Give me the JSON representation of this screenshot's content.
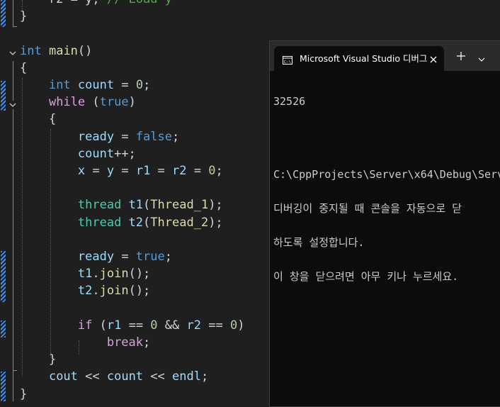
{
  "editor": {
    "lines": [
      {
        "id": "l0",
        "tokens": [
          [
            "op",
            "    r2 = y; "
          ],
          [
            "cmt",
            "// Load y"
          ]
        ]
      },
      {
        "id": "l1",
        "tokens": [
          [
            "op",
            "}"
          ]
        ]
      },
      {
        "id": "l2",
        "tokens": []
      },
      {
        "id": "l3",
        "tokens": [
          [
            "kw",
            "int"
          ],
          [
            "op",
            " "
          ],
          [
            "fn",
            "main"
          ],
          [
            "op",
            "()"
          ]
        ]
      },
      {
        "id": "l4",
        "tokens": [
          [
            "op",
            "{"
          ]
        ]
      },
      {
        "id": "l5",
        "tokens": [
          [
            "op",
            "    "
          ],
          [
            "kw",
            "int"
          ],
          [
            "op",
            " "
          ],
          [
            "var",
            "count"
          ],
          [
            "op",
            " = "
          ],
          [
            "num",
            "0"
          ],
          [
            "op",
            ";"
          ]
        ]
      },
      {
        "id": "l6",
        "tokens": [
          [
            "op",
            "    "
          ],
          [
            "ctl",
            "while"
          ],
          [
            "op",
            " ("
          ],
          [
            "kw",
            "true"
          ],
          [
            "op",
            ")"
          ]
        ]
      },
      {
        "id": "l7",
        "tokens": [
          [
            "op",
            "    {"
          ]
        ]
      },
      {
        "id": "l8",
        "tokens": [
          [
            "op",
            "        "
          ],
          [
            "var",
            "ready"
          ],
          [
            "op",
            " = "
          ],
          [
            "kw",
            "false"
          ],
          [
            "op",
            ";"
          ]
        ]
      },
      {
        "id": "l9",
        "tokens": [
          [
            "op",
            "        "
          ],
          [
            "var",
            "count"
          ],
          [
            "op",
            "++;"
          ]
        ]
      },
      {
        "id": "l10",
        "tokens": [
          [
            "op",
            "        "
          ],
          [
            "var",
            "x"
          ],
          [
            "op",
            " = "
          ],
          [
            "var",
            "y"
          ],
          [
            "op",
            " = "
          ],
          [
            "var",
            "r1"
          ],
          [
            "op",
            " = "
          ],
          [
            "var",
            "r2"
          ],
          [
            "op",
            " = "
          ],
          [
            "num",
            "0"
          ],
          [
            "op",
            ";"
          ]
        ]
      },
      {
        "id": "l11",
        "tokens": []
      },
      {
        "id": "l12",
        "tokens": [
          [
            "op",
            "        "
          ],
          [
            "ty",
            "thread"
          ],
          [
            "op",
            " "
          ],
          [
            "var",
            "t1"
          ],
          [
            "op",
            "("
          ],
          [
            "fn",
            "Thread_1"
          ],
          [
            "op",
            ");"
          ]
        ]
      },
      {
        "id": "l13",
        "tokens": [
          [
            "op",
            "        "
          ],
          [
            "ty",
            "thread"
          ],
          [
            "op",
            " "
          ],
          [
            "var",
            "t2"
          ],
          [
            "op",
            "("
          ],
          [
            "fn",
            "Thread_2"
          ],
          [
            "op",
            ");"
          ]
        ]
      },
      {
        "id": "l14",
        "tokens": []
      },
      {
        "id": "l15",
        "tokens": [
          [
            "op",
            "        "
          ],
          [
            "var",
            "ready"
          ],
          [
            "op",
            " = "
          ],
          [
            "kw",
            "true"
          ],
          [
            "op",
            ";"
          ]
        ]
      },
      {
        "id": "l16",
        "tokens": [
          [
            "op",
            "        "
          ],
          [
            "var",
            "t1"
          ],
          [
            "op",
            "."
          ],
          [
            "fn",
            "join"
          ],
          [
            "op",
            "();"
          ]
        ]
      },
      {
        "id": "l17",
        "tokens": [
          [
            "op",
            "        "
          ],
          [
            "var",
            "t2"
          ],
          [
            "op",
            "."
          ],
          [
            "fn",
            "join"
          ],
          [
            "op",
            "();"
          ]
        ]
      },
      {
        "id": "l18",
        "tokens": []
      },
      {
        "id": "l19",
        "tokens": [
          [
            "op",
            "        "
          ],
          [
            "ctl",
            "if"
          ],
          [
            "op",
            " ("
          ],
          [
            "var",
            "r1"
          ],
          [
            "op",
            " == "
          ],
          [
            "num",
            "0"
          ],
          [
            "op",
            " && "
          ],
          [
            "var",
            "r2"
          ],
          [
            "op",
            " == "
          ],
          [
            "num",
            "0"
          ],
          [
            "op",
            ")"
          ]
        ]
      },
      {
        "id": "l20",
        "tokens": [
          [
            "op",
            "            "
          ],
          [
            "ctl",
            "break"
          ],
          [
            "op",
            ";"
          ]
        ]
      },
      {
        "id": "l21",
        "tokens": [
          [
            "op",
            "    }"
          ]
        ]
      },
      {
        "id": "l22",
        "tokens": [
          [
            "op",
            "    "
          ],
          [
            "var",
            "cout"
          ],
          [
            "op",
            " << "
          ],
          [
            "var",
            "count"
          ],
          [
            "op",
            " << "
          ],
          [
            "var",
            "endl"
          ],
          [
            "op",
            ";"
          ]
        ]
      },
      {
        "id": "l23",
        "tokens": [
          [
            "op",
            "}"
          ]
        ]
      }
    ]
  },
  "console": {
    "tab_title": "Microsoft Visual Studio 디버그",
    "new_tab_icon": "plus-icon",
    "dropdown_icon": "chevron-down-icon",
    "close_icon": "close-icon",
    "output": [
      "32526",
      "",
      "C:\\CppProjects\\Server\\x64\\Debug\\Serv",
      "디버깅이 중지될 때 콘솔을 자동으로 닫",
      "하도록 설정합니다.",
      "이 창을 닫으려면 아무 키나 누르세요."
    ]
  },
  "colors": {
    "editor_bg": "#1f1f1f",
    "console_bg": "#0c0c0c",
    "keyword": "#569cd6",
    "control": "#d8a0df",
    "type": "#4ec9b0",
    "variable": "#9cdcfe",
    "function": "#dcdcaa",
    "number": "#b5cea8",
    "comment": "#57a64a"
  }
}
